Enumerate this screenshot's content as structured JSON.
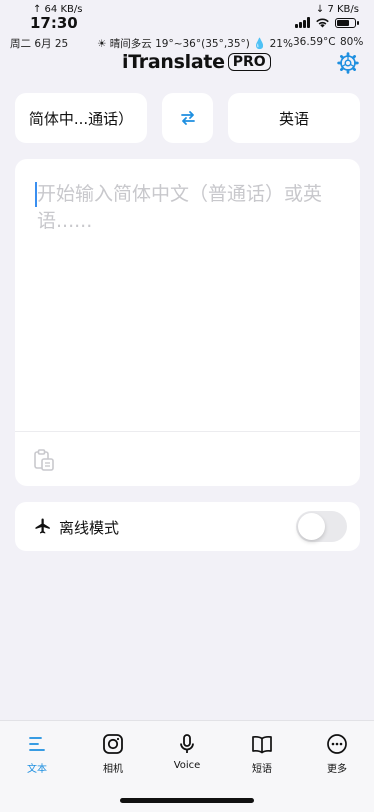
{
  "status": {
    "upload_speed": "↑ 64 KB/s",
    "download_speed": "↓ 7 KB/s",
    "time": "17:30",
    "date": "周二 6月 25",
    "weather": "☀ 晴间多云 19°~36°(35°,35°) 💧 21%",
    "temperature": "36.59°C",
    "battery_percent": "80%",
    "battery_level": 0.8
  },
  "header": {
    "brand_name": "iTranslate",
    "brand_badge": "PRO",
    "settings_icon": "gear-icon"
  },
  "language_bar": {
    "source_language": "简体中...通话）",
    "swap_icon": "swap-arrows-icon",
    "target_language": "英语"
  },
  "input": {
    "placeholder": "开始输入简体中文（普通话）或英语......",
    "paste_icon": "clipboard-paste-icon"
  },
  "offline": {
    "label": "离线模式",
    "icon": "airplane-icon",
    "enabled": false
  },
  "tabs": [
    {
      "label": "文本",
      "icon": "text-lines-icon",
      "active": true
    },
    {
      "label": "相机",
      "icon": "camera-icon",
      "active": false
    },
    {
      "label": "Voice",
      "icon": "microphone-icon",
      "active": false
    },
    {
      "label": "短语",
      "icon": "book-icon",
      "active": false
    },
    {
      "label": "更多",
      "icon": "more-dots-icon",
      "active": false
    }
  ],
  "colors": {
    "accent": "#1e8fe0",
    "background": "#f2f1f7",
    "card": "#ffffff",
    "placeholder": "#c8c8cc"
  }
}
